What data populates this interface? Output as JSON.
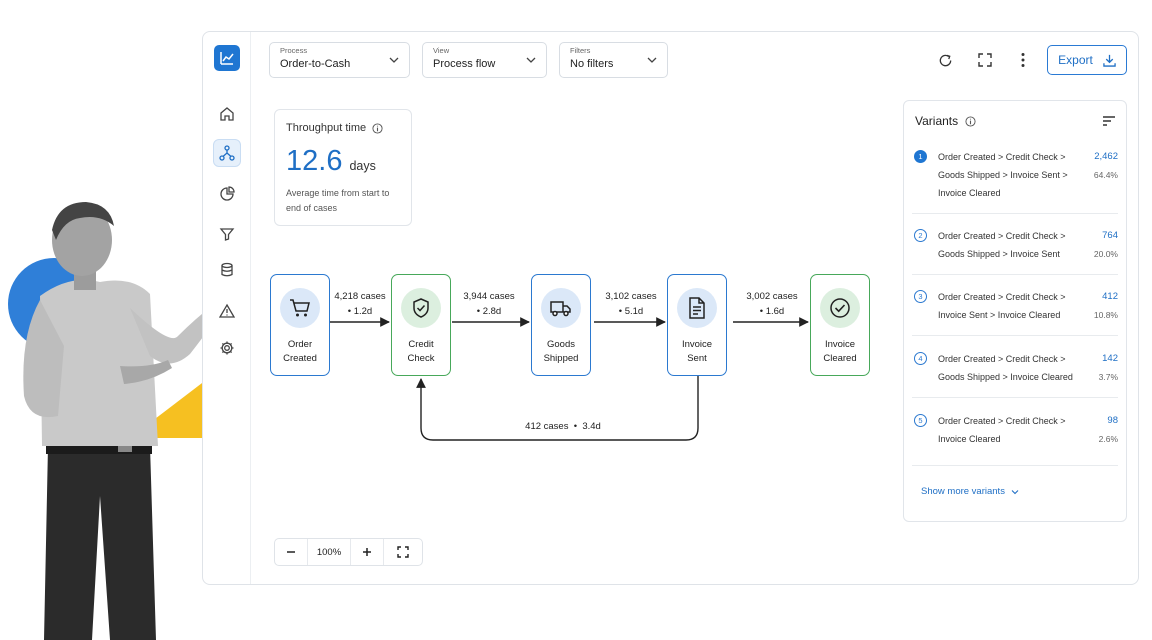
{
  "toolbar": {
    "process": {
      "label": "Process",
      "value": "Order-to-Cash"
    },
    "view": {
      "label": "View",
      "value": "Process flow"
    },
    "filters": {
      "label": "Filters",
      "value": "No filters"
    },
    "export_label": "Export"
  },
  "throughput": {
    "title": "Throughput time",
    "value": "12.6",
    "unit": "days",
    "description": "Average time from start to end of cases"
  },
  "flow": {
    "nodes": [
      {
        "line1": "Order",
        "line2": "Created",
        "icon": "cart-icon"
      },
      {
        "line1": "Credit",
        "line2": "Check",
        "icon": "shield-check-icon"
      },
      {
        "line1": "Goods",
        "line2": "Shipped",
        "icon": "truck-icon"
      },
      {
        "line1": "Invoice",
        "line2": "Sent",
        "icon": "document-icon"
      },
      {
        "line1": "Invoice",
        "line2": "Cleared",
        "icon": "check-circle-icon"
      }
    ],
    "edges": [
      {
        "cases": "4,218 cases",
        "time": "• 1.2d"
      },
      {
        "cases": "3,944 cases",
        "time": "• 2.8d"
      },
      {
        "cases": "3,102 cases",
        "time": "• 5.1d"
      },
      {
        "cases": "3,002 cases",
        "time": "• 1.6d"
      }
    ],
    "loop": "412 cases  •  3.4d"
  },
  "zoom": {
    "level": "100%"
  },
  "variants": {
    "title": "Variants",
    "items": [
      {
        "num": "1",
        "line1": "Order Created > Credit Check >",
        "line2": "Goods Shipped > Invoice Sent >",
        "line3": "Invoice Cleared",
        "count": "2,462",
        "pct": "64.4%"
      },
      {
        "num": "2",
        "line1": "Order Created > Credit Check >",
        "line2": "Goods Shipped > Invoice Sent",
        "line3": "",
        "count": "764",
        "pct": "20.0%"
      },
      {
        "num": "3",
        "line1": "Order Created > Credit Check >",
        "line2": "Invoice Sent > Invoice Cleared",
        "line3": "",
        "count": "412",
        "pct": "10.8%"
      },
      {
        "num": "4",
        "line1": "Order Created > Credit Check >",
        "line2": "Goods Shipped > Invoice Cleared",
        "line3": "",
        "count": "142",
        "pct": "3.7%"
      },
      {
        "num": "5",
        "line1": "Order Created > Credit Check >",
        "line2": "Invoice Cleared",
        "line3": "",
        "count": "98",
        "pct": "2.6%"
      }
    ],
    "show_more": "Show more variants"
  },
  "colors": {
    "accent": "#1f76d2",
    "success": "#47a85a",
    "deco_blue": "#2f7fd8",
    "deco_yellow": "#f6c021"
  }
}
